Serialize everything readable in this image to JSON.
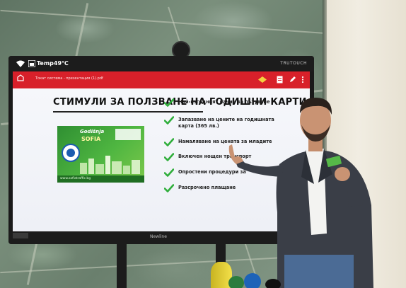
{
  "display": {
    "status_temp": "Temp49℃",
    "brand_top": "TRUTOUCH",
    "brand_bottom": "Newline"
  },
  "viewer": {
    "file_name": "Токат системa - презентация (1).pdf"
  },
  "slide": {
    "title": "СТИМУЛИ ЗА ПОЛЗВАНЕ НА ГОДИШНИ КАРТИ",
    "card": {
      "brand": "Godišnja",
      "city": "SOFIA",
      "url": "www.sofiatraffic.bg"
    },
    "checklist": [
      "Най-изгодният начин за пътуване",
      "Запазване на цените на годишната\nкарта (365 лв.)",
      "Намаляване на цената за младите",
      "Включен нощен транспорт",
      "Опростени процедури за",
      "Разсрочено плащане"
    ]
  },
  "colors": {
    "viewer_bar": "#d8202a",
    "check_green": "#2fae3b",
    "card_green": "#4fb641"
  }
}
